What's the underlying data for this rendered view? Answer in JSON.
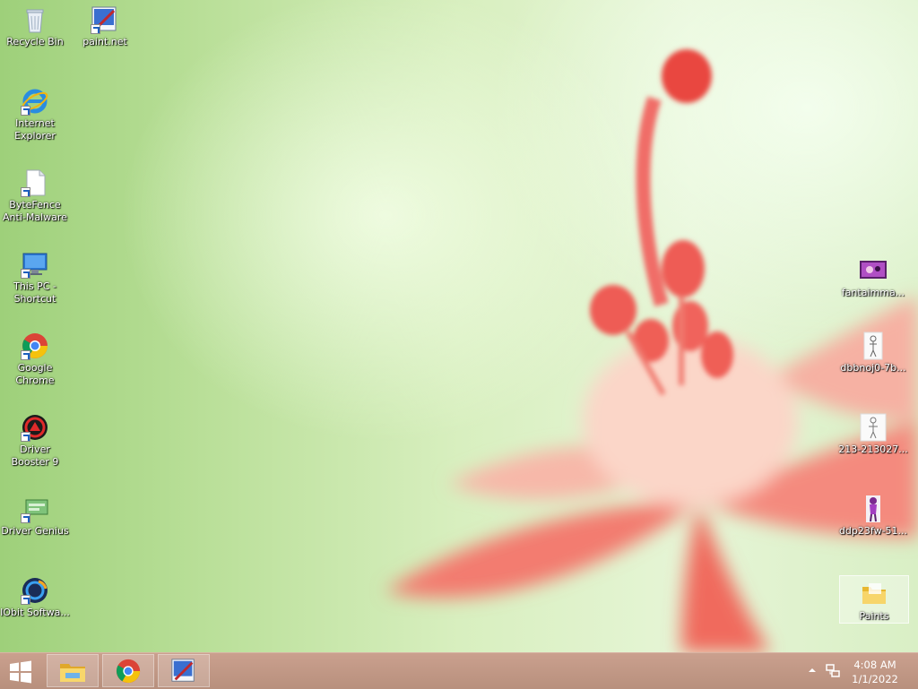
{
  "desktop": {
    "left_icons": [
      {
        "label": "Recycle Bin",
        "icon": "recycle-bin-icon"
      },
      {
        "label": "paint.net",
        "icon": "paintnet-icon"
      },
      {
        "label": "Internet Explorer",
        "icon": "internet-explorer-icon"
      },
      {
        "label": "ByteFence Anti-Malware",
        "icon": "document-icon"
      },
      {
        "label": "This PC - Shortcut",
        "icon": "this-pc-icon"
      },
      {
        "label": "Google Chrome",
        "icon": "chrome-icon"
      },
      {
        "label": "Driver Booster 9",
        "icon": "driver-booster-icon"
      },
      {
        "label": "Driver Genius",
        "icon": "driver-genius-icon"
      },
      {
        "label": "IObit Softwa...",
        "icon": "iobit-icon"
      }
    ],
    "right_icons": [
      {
        "label": "fantaimma...",
        "icon": "image-thumbnail-icon"
      },
      {
        "label": "dbbnoj0-7b...",
        "icon": "image-thumbnail-icon"
      },
      {
        "label": "213-213027...",
        "icon": "image-thumbnail-icon"
      },
      {
        "label": "ddp23fw-51...",
        "icon": "image-thumbnail-icon"
      },
      {
        "label": "Paints",
        "icon": "folder-icon"
      }
    ]
  },
  "taskbar": {
    "pinned": [
      {
        "name": "file-explorer",
        "icon": "file-explorer-icon"
      },
      {
        "name": "google-chrome",
        "icon": "chrome-icon"
      },
      {
        "name": "paint.net",
        "icon": "paintnet-icon"
      }
    ],
    "tray": {
      "show_hidden_icon": "chevron-up-icon",
      "network_icon": "network-icon"
    },
    "clock": {
      "time": "4:08 AM",
      "date": "1/1/2022"
    }
  }
}
